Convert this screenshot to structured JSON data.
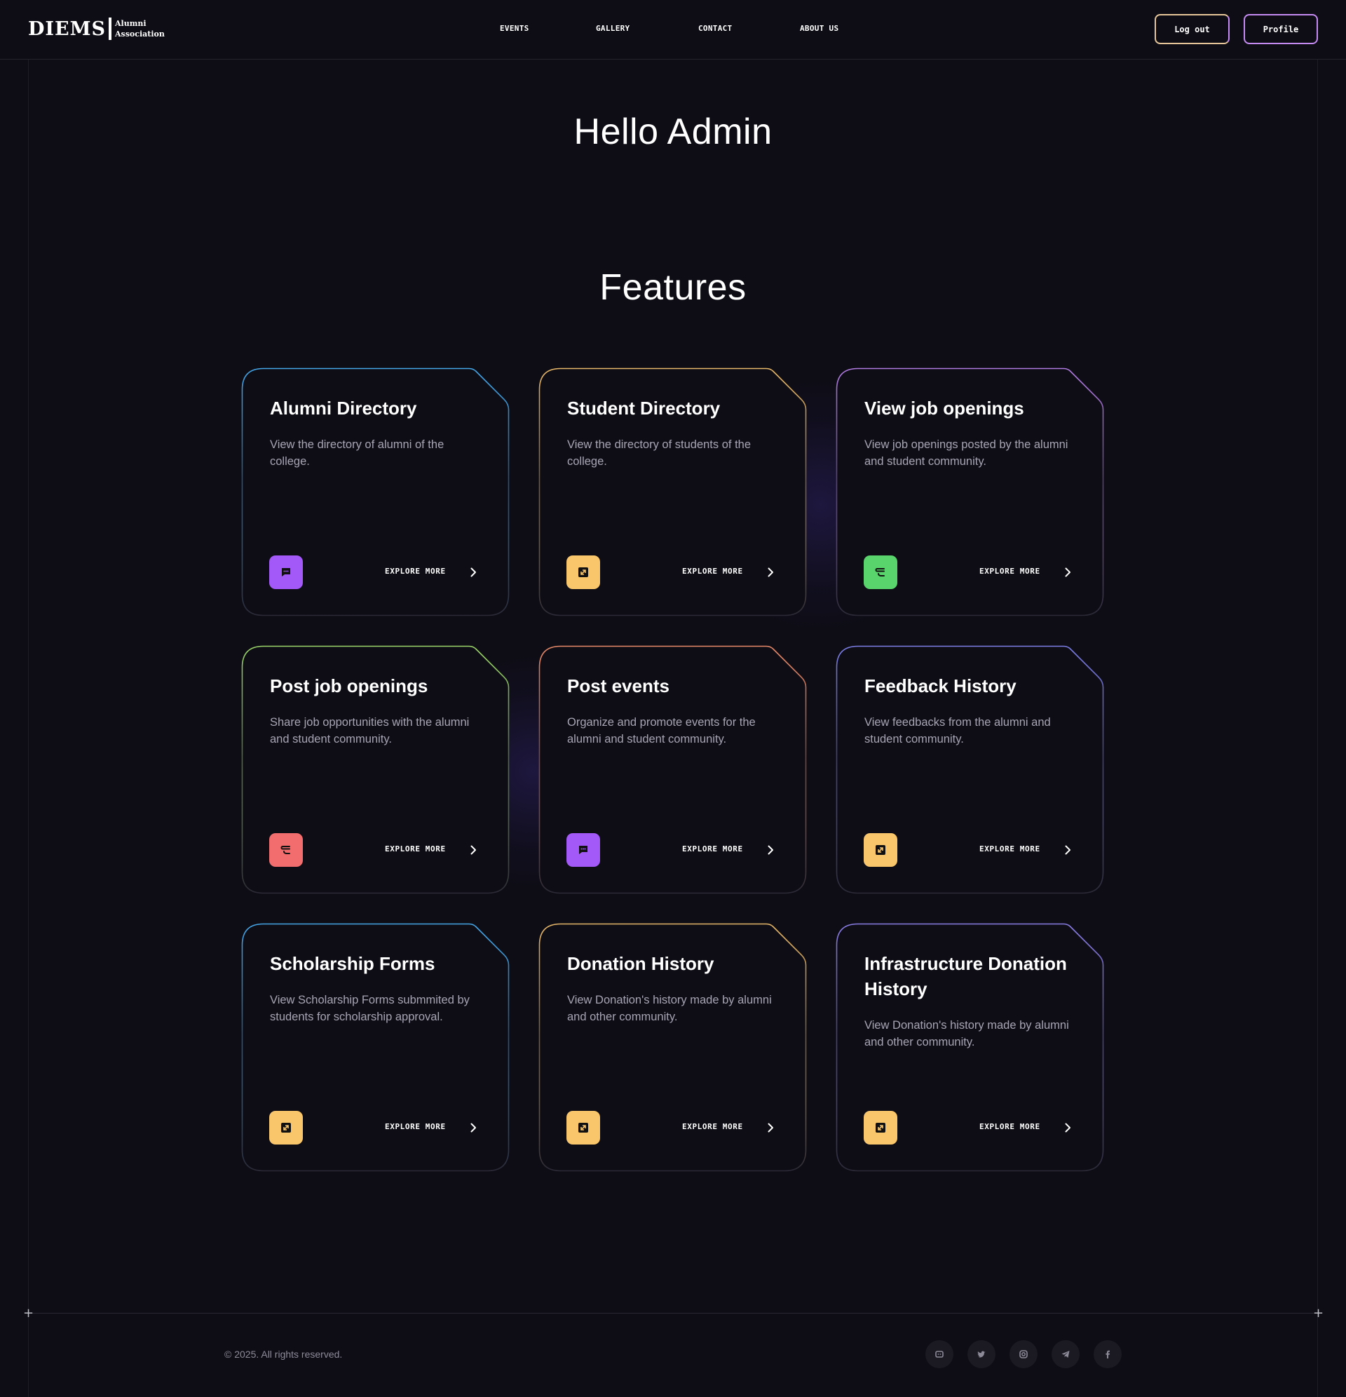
{
  "header": {
    "logo_main": "DIEMS",
    "logo_sub_line1": "Alumni",
    "logo_sub_line2": "Association",
    "nav": [
      "EVENTS",
      "GALLERY",
      "CONTACT",
      "ABOUT US"
    ],
    "logout_label": "Log out",
    "profile_label": "Profile"
  },
  "main": {
    "greeting": "Hello Admin",
    "features_title": "Features",
    "explore_label": "EXPLORE MORE"
  },
  "cards": [
    {
      "title": "Alumni Directory",
      "desc": "View the directory of alumni of the college.",
      "icon": "chat-icon",
      "icon_color": "#a259f7",
      "border": "#45a6e8"
    },
    {
      "title": "Student Directory",
      "desc": "View the directory of students of the college.",
      "icon": "expand-icon",
      "icon_color": "#f9c66c",
      "border": "#e8b86a"
    },
    {
      "title": "View job openings",
      "desc": "View job openings posted by the alumni and student community.",
      "icon": "stack-icon",
      "icon_color": "#59d36c",
      "border": "#b07be0"
    },
    {
      "title": "Post job openings",
      "desc": "Share job opportunities with the alumni and student community.",
      "icon": "stack-icon",
      "icon_color": "#f26d6d",
      "border": "#9bd66a"
    },
    {
      "title": "Post events",
      "desc": "Organize and promote events for the alumni and student community.",
      "icon": "chat-icon",
      "icon_color": "#a259f7",
      "border": "#e88a6a"
    },
    {
      "title": "Feedback History",
      "desc": "View feedbacks from the alumni and student community.",
      "icon": "expand-icon",
      "icon_color": "#f9c66c",
      "border": "#7c7ee6"
    },
    {
      "title": "Scholarship Forms",
      "desc": "View Scholarship Forms submmited by students for scholarship approval.",
      "icon": "expand-icon",
      "icon_color": "#f9c66c",
      "border": "#45a6e8"
    },
    {
      "title": "Donation History",
      "desc": "View Donation's history made by alumni and other community.",
      "icon": "expand-icon",
      "icon_color": "#f9c66c",
      "border": "#e8b86a"
    },
    {
      "title": "Infrastructure Donation History",
      "desc": "View Donation's history made by alumni and other community.",
      "icon": "expand-icon",
      "icon_color": "#f9c66c",
      "border": "#8a7ee6"
    }
  ],
  "footer": {
    "copyright": "© 2025. All rights reserved.",
    "social": [
      "discord-icon",
      "twitter-icon",
      "instagram-icon",
      "telegram-icon",
      "facebook-icon"
    ]
  }
}
